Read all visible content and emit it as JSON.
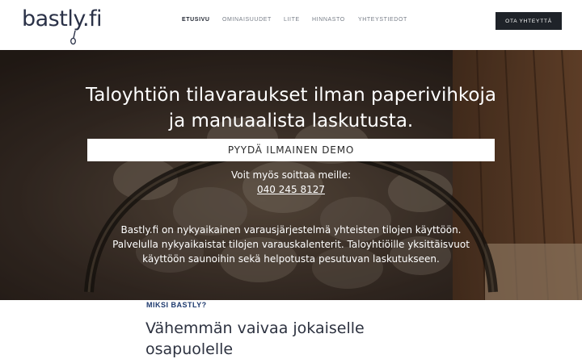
{
  "header": {
    "logo_text": "bastly.fi",
    "nav": [
      {
        "label": "ETUSIVU",
        "active": true
      },
      {
        "label": "OMINAISUUDET",
        "active": false
      },
      {
        "label": "LIITE",
        "active": false
      },
      {
        "label": "HINNASTO",
        "active": false
      },
      {
        "label": "YHTEYSTIEDOT",
        "active": false
      }
    ],
    "cta_label": "OTA YHTEYTTÄ"
  },
  "hero": {
    "title_line1": "Taloyhtiön tilavaraukset ilman paperivihkoja",
    "title_line2": "ja manuaalista laskutusta.",
    "demo_button": "PYYDÄ ILMAINEN DEMO",
    "call_text": "Voit myös soittaa meille:",
    "phone": "040 245 8127",
    "desc_line1": "Bastly.fi on nykyaikainen varausjärjestelmä yhteisten tilojen käyttöön.",
    "desc_line2": "Palvelulla nykyaikaistat tilojen varauskalenterit. Taloyhtiöille yksittäisvuot",
    "desc_line3": "käyttöön saunoihin sekä helpotusta pesutuvan laskutukseen."
  },
  "section": {
    "label": "MIKSI BASTLY?",
    "heading_line1": "Vähemmän vaivaa jokaiselle",
    "heading_line2": "osapuolelle"
  },
  "colors": {
    "brand": "#2a3147",
    "accent_label": "#1e3a6e",
    "cta_bg": "#1f2329"
  }
}
